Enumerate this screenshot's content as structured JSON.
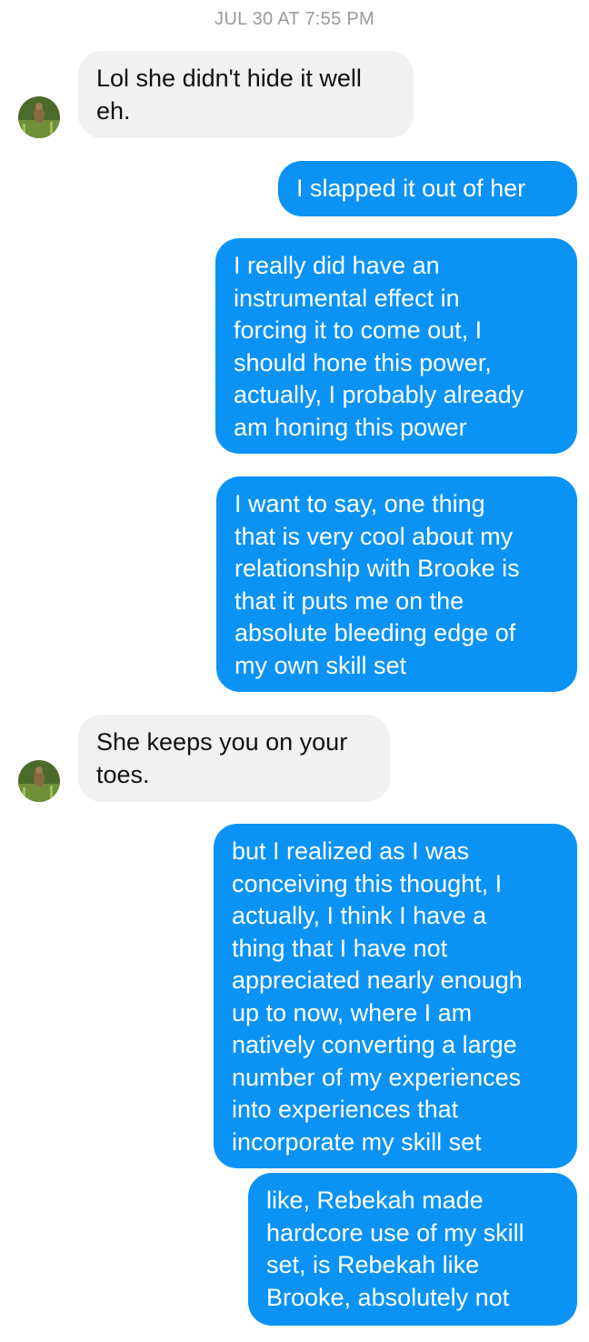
{
  "thread": {
    "timestamp": "JUL 30 AT 7:55 PM",
    "messages": [
      {
        "from": "them",
        "text": "Lol she didn't hide it well\neh."
      },
      {
        "from": "me",
        "text": "I slapped it out of her"
      },
      {
        "from": "me",
        "text": "I really did have an\ninstrumental effect in\nforcing it to come out, I\nshould hone this power,\nactually, I probably already\nam honing this power"
      },
      {
        "from": "me",
        "text": "I want to say, one thing\nthat is very cool about my\nrelationship with Brooke is\nthat it puts me on the\nabsolute bleeding edge of\nmy own skill set"
      },
      {
        "from": "them",
        "text": "She keeps you on your\ntoes."
      },
      {
        "from": "me",
        "text": "but I realized as I was\nconceiving this thought, I\nactually, I think I have a\nthing that I have not\nappreciated nearly enough\nup to now, where I am\nnatively converting a large\nnumber of my experiences\ninto experiences that\nincorporate my skill set"
      },
      {
        "from": "me",
        "text": "like, Rebekah made\nhardcore use of my skill\nset, is Rebekah like\nBrooke, absolutely not"
      }
    ]
  },
  "colors": {
    "outgoing_bubble": "#0a93f5",
    "incoming_bubble": "#f1f1f1",
    "timestamp_text": "#9a9a9a"
  },
  "icons": {
    "contact_avatar": "avatar-photo-icon"
  }
}
